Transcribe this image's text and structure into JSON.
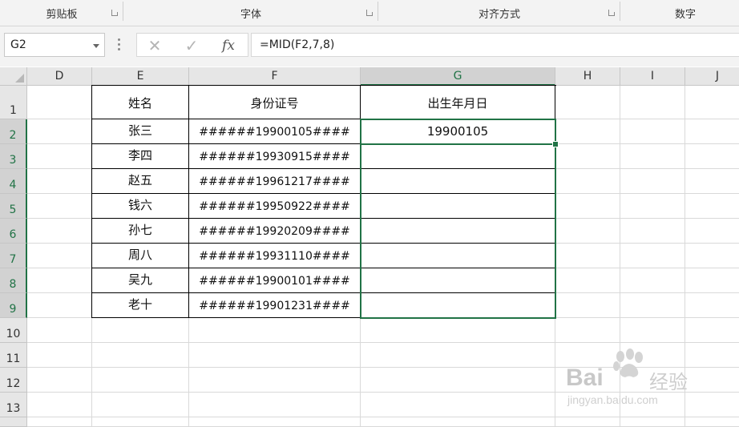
{
  "ribbon": {
    "groups": [
      {
        "label": "剪贴板"
      },
      {
        "label": "字体"
      },
      {
        "label": "对齐方式"
      },
      {
        "label": "数字"
      }
    ]
  },
  "formula_bar": {
    "name_box": "G2",
    "cancel_icon": "close-icon",
    "enter_icon": "check-icon",
    "fx_label": "fx",
    "formula": "=MID(F2,7,8)"
  },
  "columns": [
    "D",
    "E",
    "F",
    "G",
    "H",
    "I",
    "J"
  ],
  "rows": [
    "1",
    "2",
    "3",
    "4",
    "5",
    "6",
    "7",
    "8",
    "9",
    "10",
    "11",
    "12",
    "13"
  ],
  "table": {
    "headers": {
      "name": "姓名",
      "id": "身份证号",
      "birth": "出生年月日"
    },
    "records": [
      {
        "name": "张三",
        "id": "######19900105####",
        "birth": "19900105"
      },
      {
        "name": "李四",
        "id": "######19930915####",
        "birth": ""
      },
      {
        "name": "赵五",
        "id": "######19961217####",
        "birth": ""
      },
      {
        "name": "钱六",
        "id": "######19950922####",
        "birth": ""
      },
      {
        "name": "孙七",
        "id": "######19920209####",
        "birth": ""
      },
      {
        "name": "周八",
        "id": "######19931110####",
        "birth": ""
      },
      {
        "name": "吴九",
        "id": "######19900101####",
        "birth": ""
      },
      {
        "name": "老十",
        "id": "######19901231####",
        "birth": ""
      }
    ]
  },
  "selection": {
    "active_cell": "G2",
    "range": "G2:G9"
  },
  "colors": {
    "accent": "#217346"
  },
  "watermark": {
    "brand": "Bai",
    "brand_cn": "经验",
    "url": "jingyan.baidu.com"
  }
}
